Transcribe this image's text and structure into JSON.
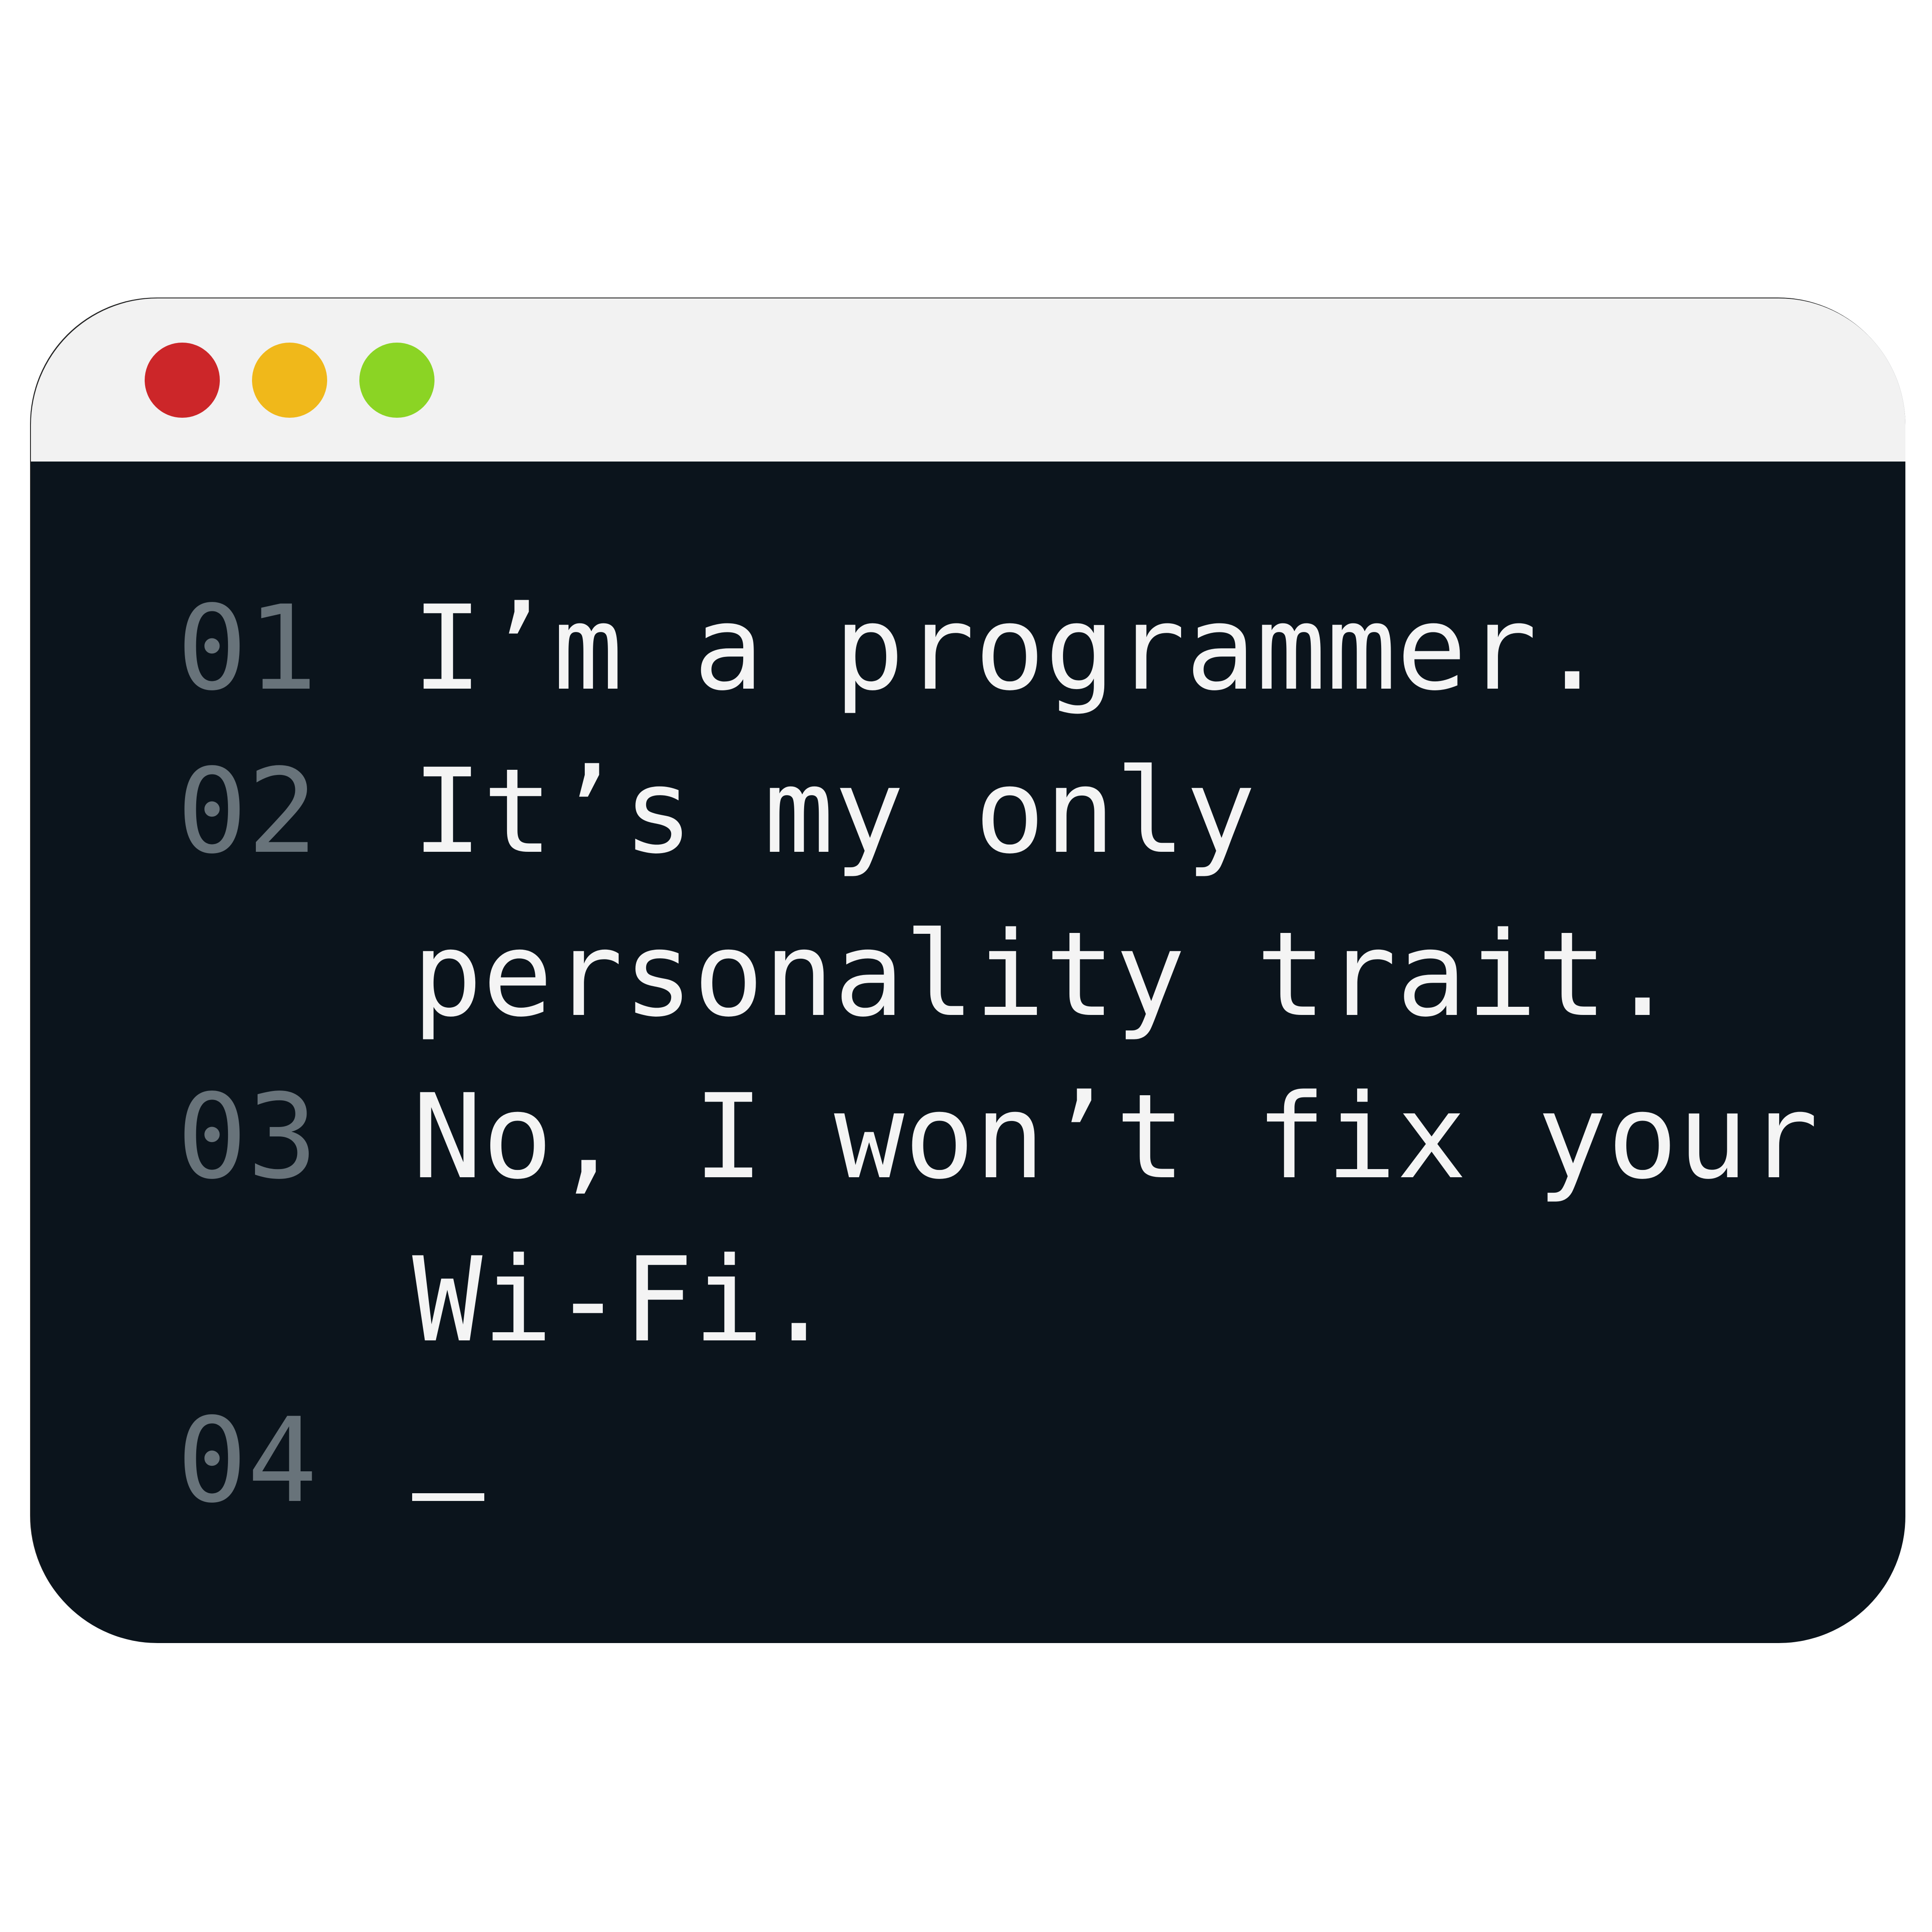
{
  "window": {
    "controls": [
      {
        "name": "close",
        "color": "#cc2629"
      },
      {
        "name": "minimize",
        "color": "#f0b81a"
      },
      {
        "name": "maximize",
        "color": "#8bd424"
      }
    ]
  },
  "editor": {
    "lines": [
      {
        "number": "01",
        "text": "I’m a programmer."
      },
      {
        "number": "02",
        "text": "It’s my only"
      },
      {
        "number": "",
        "text": "personality trait."
      },
      {
        "number": "03",
        "text": "No, I won’t fix your"
      },
      {
        "number": "",
        "text": "Wi-Fi."
      },
      {
        "number": "04",
        "text": ""
      }
    ],
    "cursor_glyph": "_"
  }
}
